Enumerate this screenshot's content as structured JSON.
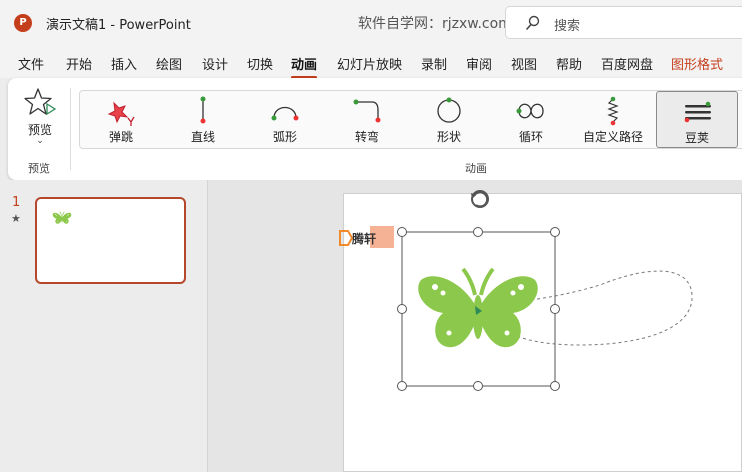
{
  "titlebar": {
    "app_icon_letter": "P",
    "doc_title": "演示文稿1  -  PowerPoint",
    "watermark": "软件自学网：rjzxw.com",
    "search_placeholder": "搜索"
  },
  "menu": {
    "items": [
      "文件",
      "开始",
      "插入",
      "绘图",
      "设计",
      "切换",
      "动画",
      "幻灯片放映",
      "录制",
      "审阅",
      "视图",
      "帮助",
      "百度网盘",
      "图形格式"
    ],
    "active": "动画",
    "accent": "图形格式"
  },
  "ribbon": {
    "preview_label": "预览",
    "preview_chevron": "⌄",
    "preview_group_label": "预览",
    "animation_group_label": "动画",
    "effects": [
      {
        "label": "弹跳",
        "icon": "bounce-icon"
      },
      {
        "label": "直线",
        "icon": "line-path-icon"
      },
      {
        "label": "弧形",
        "icon": "arc-path-icon"
      },
      {
        "label": "转弯",
        "icon": "turn-path-icon"
      },
      {
        "label": "形状",
        "icon": "shape-path-icon"
      },
      {
        "label": "循环",
        "icon": "loop-path-icon"
      },
      {
        "label": "自定义路径",
        "icon": "custom-path-icon"
      },
      {
        "label": "豆荚",
        "icon": "peanut-path-icon"
      }
    ],
    "selected_effect": "豆荚"
  },
  "slides_pane": {
    "slide_number": "1",
    "slide_star": "★"
  },
  "stage": {
    "badge_text": "腾轩",
    "butterfly_color": "#8cc84b",
    "accent_color": "#c43e1c"
  }
}
